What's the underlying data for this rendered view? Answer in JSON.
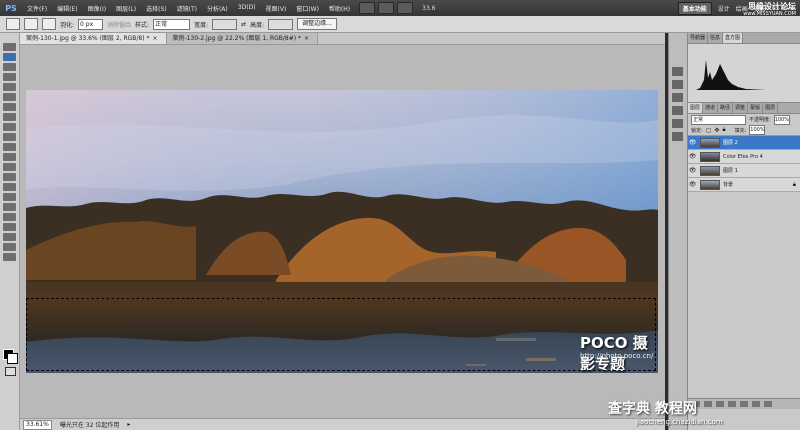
{
  "app": {
    "logo": "PS",
    "menus": [
      "文件(F)",
      "编辑(E)",
      "图像(I)",
      "图层(L)",
      "选择(S)",
      "滤镜(T)",
      "分析(A)",
      "3D(D)",
      "视图(V)",
      "窗口(W)",
      "帮助(H)"
    ],
    "zoom_display": "33.6",
    "workspace": "基本功能",
    "top_right_partial": [
      "设计",
      "绘画",
      "摄影"
    ],
    "cs_live": "CS Live",
    "watermark_top": "思缘设计论坛",
    "watermark_top_url": "www.MISSYUAN.COM"
  },
  "options": {
    "feather_label": "羽化:",
    "feather_value": "0 px",
    "antialias_label": "消除锯齿",
    "style_label": "样式:",
    "style_value": "正常",
    "width_label": "宽度:",
    "height_label": "高度:",
    "refine_button": "调整边缘..."
  },
  "tabs": [
    {
      "label": "案例-130-1.jpg @ 33.6% (图层 2, RGB/8) *",
      "active": true
    },
    {
      "label": "案例-130-2.jpg @ 22.2% (图层 1, RGB/8#) *",
      "active": false
    }
  ],
  "status": {
    "zoom": "33.61%",
    "text": "曝光只在 32 位起作用"
  },
  "panels": {
    "top_tabs": [
      "导航器",
      "信息",
      "直方图"
    ],
    "layer_tabs": [
      "图层",
      "通道",
      "路径",
      "调整",
      "蒙版",
      "图层"
    ],
    "blend_mode": "正常",
    "opacity_label": "不透明度:",
    "opacity_value": "100%",
    "lock_label": "锁定:",
    "fill_label": "填充:",
    "fill_value": "100%",
    "layers": [
      {
        "name": "图层 2",
        "active": true
      },
      {
        "name": "Color Efex Pro 4",
        "active": false
      },
      {
        "name": "图层 1",
        "active": false
      },
      {
        "name": "背景",
        "active": false
      }
    ]
  },
  "watermark": {
    "poco": "POCO 摄影专题",
    "poco_url": "http://photo.poco.cn/",
    "bottom": "查字典 教程网",
    "bottom_url": "jiaocheng.chazidian.com"
  }
}
